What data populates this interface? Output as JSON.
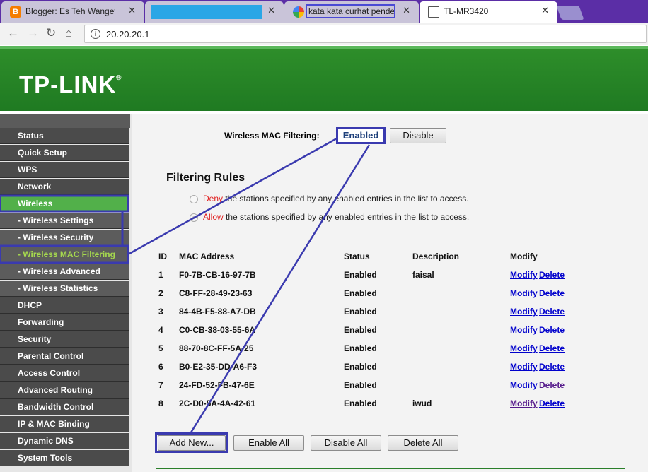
{
  "browser": {
    "tabs": [
      {
        "title": "Blogger: Es Teh Wanget",
        "close": "✕"
      },
      {
        "title": "",
        "close": "✕"
      },
      {
        "title": "kata kata curhat pendek",
        "close": "✕"
      },
      {
        "title": "TL-MR3420",
        "close": "✕"
      }
    ],
    "blogger_icon_letter": "B",
    "url": "20.20.20.1",
    "nav": {
      "back": "←",
      "forward": "→",
      "reload": "↻",
      "home": "⌂",
      "info": "i"
    }
  },
  "header": {
    "logo": "TP-LINK",
    "logo_mark": "®"
  },
  "sidebar": {
    "items": [
      {
        "label": "Status"
      },
      {
        "label": "Quick Setup"
      },
      {
        "label": "WPS"
      },
      {
        "label": "Network"
      },
      {
        "label": "Wireless"
      },
      {
        "label": "- Wireless Settings"
      },
      {
        "label": "- Wireless Security"
      },
      {
        "label": "- Wireless MAC Filtering"
      },
      {
        "label": "- Wireless Advanced"
      },
      {
        "label": "- Wireless Statistics"
      },
      {
        "label": "DHCP"
      },
      {
        "label": "Forwarding"
      },
      {
        "label": "Security"
      },
      {
        "label": "Parental Control"
      },
      {
        "label": "Access Control"
      },
      {
        "label": "Advanced Routing"
      },
      {
        "label": "Bandwidth Control"
      },
      {
        "label": "IP & MAC Binding"
      },
      {
        "label": "Dynamic DNS"
      },
      {
        "label": "System Tools"
      }
    ]
  },
  "filtering": {
    "label": "Wireless MAC Filtering:",
    "status": "Enabled",
    "disable_button": "Disable"
  },
  "rules": {
    "title": "Filtering Rules",
    "deny_word": "Deny",
    "deny_text": " the stations specified by any enabled entries in the list to access.",
    "allow_word": "Allow",
    "allow_text": " the stations specified by any enabled entries in the list to access."
  },
  "table": {
    "headers": [
      "ID",
      "MAC Address",
      "Status",
      "Description",
      "Modify"
    ],
    "modify_label": "Modify",
    "delete_label": "Delete",
    "rows": [
      {
        "id": "1",
        "mac": "F0-7B-CB-16-97-7B",
        "status": "Enabled",
        "description": "faisal"
      },
      {
        "id": "2",
        "mac": "C8-FF-28-49-23-63",
        "status": "Enabled",
        "description": ""
      },
      {
        "id": "3",
        "mac": "84-4B-F5-88-A7-DB",
        "status": "Enabled",
        "description": ""
      },
      {
        "id": "4",
        "mac": "C0-CB-38-03-55-6A",
        "status": "Enabled",
        "description": ""
      },
      {
        "id": "5",
        "mac": "88-70-8C-FF-5A-25",
        "status": "Enabled",
        "description": ""
      },
      {
        "id": "6",
        "mac": "B0-E2-35-DD-A6-F3",
        "status": "Enabled",
        "description": ""
      },
      {
        "id": "7",
        "mac": "24-FD-52-FB-47-6E",
        "status": "Enabled",
        "description": ""
      },
      {
        "id": "8",
        "mac": "2C-D0-5A-4A-42-61",
        "status": "Enabled",
        "description": "iwud"
      }
    ]
  },
  "actions": {
    "add_new": "Add New...",
    "enable_all": "Enable All",
    "disable_all": "Disable All",
    "delete_all": "Delete All"
  },
  "colors": {
    "banner_green": "#1f7a22",
    "menu_active_green": "#52b04a",
    "annotation_blue": "#3a3aaf",
    "link_blue": "#0000cc"
  }
}
